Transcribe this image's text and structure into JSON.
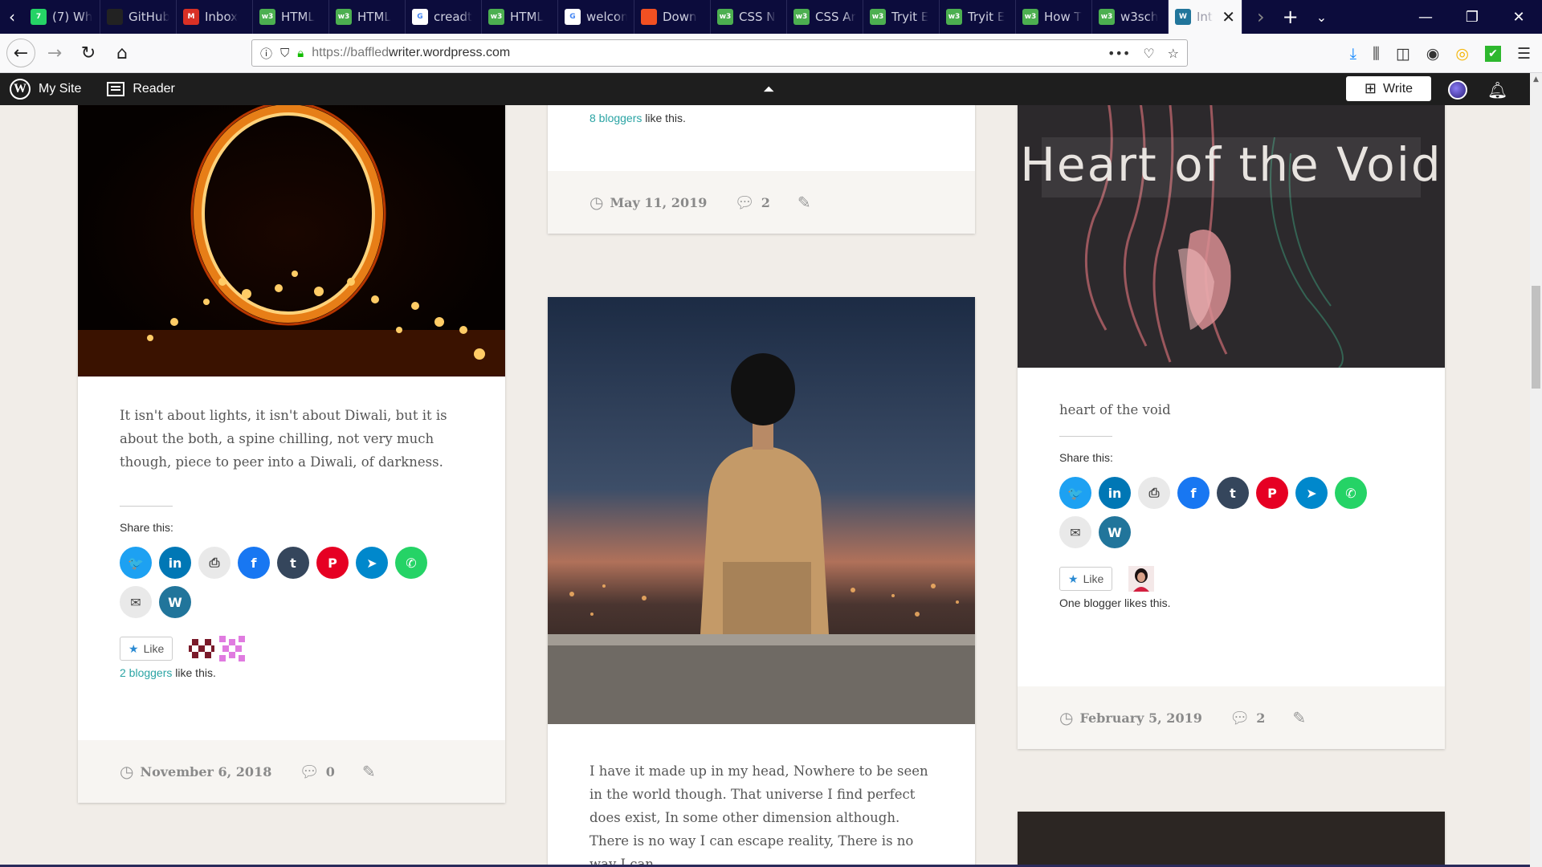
{
  "tabs": [
    {
      "title": "(7) Wh",
      "fav_color": "#25d366",
      "fav_text": "7"
    },
    {
      "title": "GitHub",
      "fav_color": "#222222",
      "fav_text": ""
    },
    {
      "title": "Inbox",
      "fav_color": "#d93025",
      "fav_text": "M"
    },
    {
      "title": "HTML",
      "fav_color": "#4caf50",
      "fav_text": "w3"
    },
    {
      "title": "HTML",
      "fav_color": "#4caf50",
      "fav_text": "w3"
    },
    {
      "title": "creadt",
      "fav_color": "#ffffff",
      "fav_text": "G"
    },
    {
      "title": "HTML",
      "fav_color": "#4caf50",
      "fav_text": "w3"
    },
    {
      "title": "welcom",
      "fav_color": "#ffffff",
      "fav_text": "G"
    },
    {
      "title": "Down",
      "fav_color": "#f25022",
      "fav_text": ""
    },
    {
      "title": "CSS N",
      "fav_color": "#4caf50",
      "fav_text": "w3"
    },
    {
      "title": "CSS Ar",
      "fav_color": "#4caf50",
      "fav_text": "w3"
    },
    {
      "title": "Tryit E",
      "fav_color": "#4caf50",
      "fav_text": "w3"
    },
    {
      "title": "Tryit E",
      "fav_color": "#4caf50",
      "fav_text": "w3"
    },
    {
      "title": "How T",
      "fav_color": "#4caf50",
      "fav_text": "w3"
    },
    {
      "title": "w3sch",
      "fav_color": "#4caf50",
      "fav_text": "w3"
    }
  ],
  "active_tab": {
    "title": "Int",
    "close": "✕"
  },
  "nav": {
    "url_prefix": "https://baffled",
    "url_domain": "writer.wordpress.com",
    "url_more": "•••"
  },
  "wpbar": {
    "my_site": "My Site",
    "reader": "Reader",
    "write": "Write"
  },
  "posts": {
    "left": {
      "excerpt": "It isn't about lights, it isn't about Diwali, but it is about the both, a spine chilling, not very much though, piece to peer into a Diwali, of darkness.",
      "share_label": "Share this:",
      "like_label": "Like",
      "likers_link": "2 bloggers",
      "likers_suffix": " like this.",
      "date": "November 6, 2018",
      "comments": "0"
    },
    "middle_top": {
      "likers_link": "8 bloggers",
      "likers_suffix": " like this.",
      "date": "May 11, 2019",
      "comments": "2"
    },
    "middle": {
      "excerpt": "I have it made up in my head, Nowhere to be seen in the world though. That universe I find perfect does exist, In some other dimension although. There is no way I can escape reality, There is no way I can"
    },
    "right": {
      "image_title": "Heart of the Void",
      "excerpt": "heart of the void",
      "share_label": "Share this:",
      "like_label": "Like",
      "likers": "One blogger likes this.",
      "date": "February 5, 2019",
      "comments": "2"
    }
  },
  "share_buttons": [
    {
      "name": "twitter",
      "color": "#1da1f2",
      "glyph": "🐦"
    },
    {
      "name": "linkedin",
      "color": "#0077b5",
      "glyph": "in"
    },
    {
      "name": "print",
      "color": "#e9e9e9",
      "glyph": "⎙"
    },
    {
      "name": "facebook",
      "color": "#1877f2",
      "glyph": "f"
    },
    {
      "name": "tumblr",
      "color": "#35465c",
      "glyph": "t"
    },
    {
      "name": "pinterest",
      "color": "#e60023",
      "glyph": "P"
    },
    {
      "name": "telegram",
      "color": "#0088cc",
      "glyph": "➤"
    },
    {
      "name": "whatsapp",
      "color": "#25d366",
      "glyph": "✆"
    },
    {
      "name": "email",
      "color": "#e9e9e9",
      "glyph": "✉"
    },
    {
      "name": "wordpress",
      "color": "#21759b",
      "glyph": "W"
    }
  ]
}
